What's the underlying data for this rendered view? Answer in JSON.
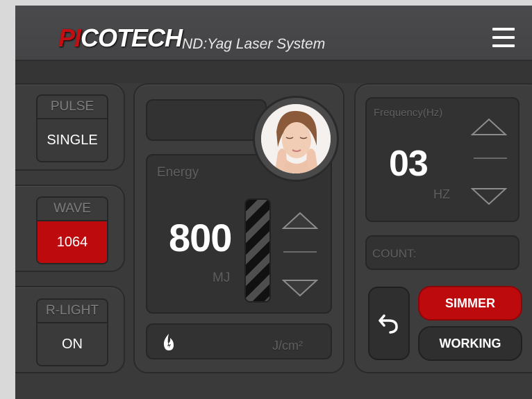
{
  "header": {
    "logo_red": "PI",
    "logo_white": "COTECH",
    "subtitle": "ND:Yag Laser System",
    "menu_icon": "hamburger-menu-icon"
  },
  "left": {
    "pulse": {
      "label": "PULSE",
      "value": "SINGLE"
    },
    "wave": {
      "label": "WAVE",
      "value": "1064"
    },
    "rlight": {
      "label": "R-LIGHT",
      "value": "ON"
    }
  },
  "center": {
    "energy_label": "Energy",
    "energy_value": "800",
    "energy_unit": "MJ",
    "fluence_unit": "J/cm²",
    "fluence_icon": "flame-icon",
    "photo_icon": "face-photo"
  },
  "right": {
    "frequency_label": "Frequency(Hz)",
    "frequency_value": "03",
    "frequency_unit": "HZ",
    "count_label": "COUNT:",
    "back_icon": "undo-arrow-icon",
    "simmer_label": "SIMMER",
    "working_label": "WORKING"
  },
  "colors": {
    "accent_red": "#bd0a0d",
    "background": "#3a3a3b"
  }
}
